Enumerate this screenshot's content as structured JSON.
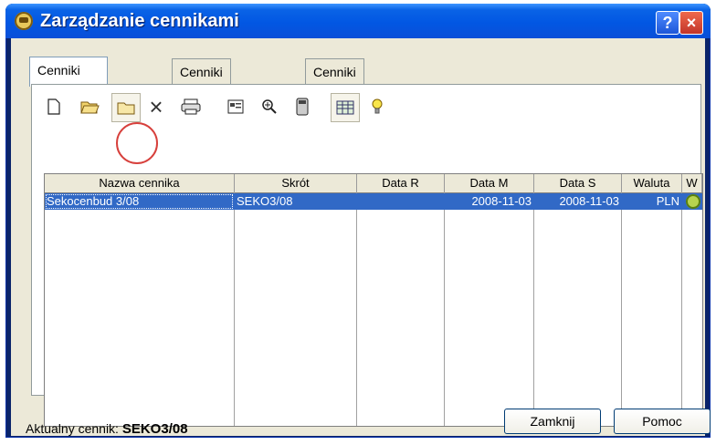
{
  "window": {
    "title": "Zarządzanie cennikami"
  },
  "tabs": [
    {
      "label": "Cenniki składników",
      "active": true
    },
    {
      "label": "Cenniki pozycji KB",
      "active": false
    },
    {
      "label": "Cenniki pozycji ZN",
      "active": false
    }
  ],
  "toolbar": {
    "icons": [
      "new-icon",
      "open-icon",
      "folder-highlighted-icon",
      "delete-icon",
      "print-icon",
      "properties-icon",
      "zoom-icon",
      "calculator-icon",
      "grid-icon",
      "bulb-icon"
    ]
  },
  "grid": {
    "columns": [
      "Nazwa cennika",
      "Skrót",
      "Data R",
      "Data M",
      "Data S",
      "Waluta",
      "W"
    ],
    "rows": [
      {
        "name": "Sekocenbud 3/08",
        "short": "SEKO3/08",
        "data_r": "",
        "data_m": "2008-11-03",
        "data_s": "2008-11-03",
        "currency": "PLN",
        "status_icon": "bulb-icon"
      }
    ]
  },
  "footer": {
    "current_label": "Aktualny cennik:",
    "current_value": "SEKO3/08",
    "close_button": "Zamknij",
    "help_button": "Pomoc"
  },
  "colors": {
    "titlebar": "#0257e3",
    "selection": "#3169c6"
  }
}
